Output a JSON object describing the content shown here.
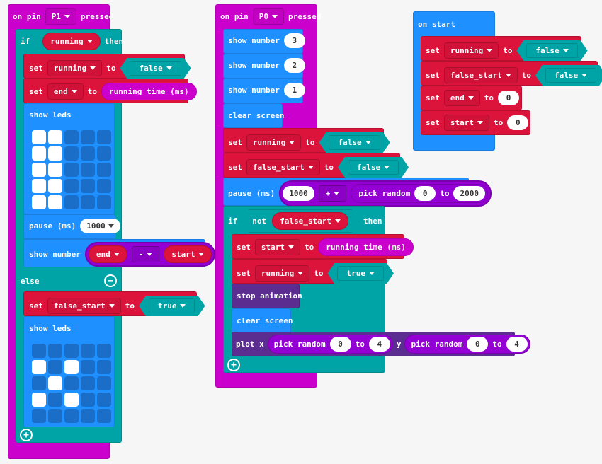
{
  "colors": {
    "background": "#f6f6f6",
    "events": "#cc00cc",
    "logic": "#00a4a6",
    "variables": "#dc143c",
    "basic": "#1e90ff",
    "led": "#5c2d91",
    "math": "#9400d3"
  },
  "stack1": {
    "event": {
      "prefix": "on pin",
      "pin": "P1",
      "suffix": "pressed"
    },
    "if": {
      "label": "if",
      "condition": "running",
      "then": "then"
    },
    "set_running": {
      "set": "set",
      "var": "running",
      "to": "to",
      "value": "false"
    },
    "set_end": {
      "set": "set",
      "var": "end",
      "to": "to",
      "value": "running time (ms)"
    },
    "show_leds_1": {
      "label": "show leds",
      "grid": [
        [
          1,
          1,
          0,
          0,
          0
        ],
        [
          1,
          1,
          0,
          0,
          0
        ],
        [
          1,
          1,
          0,
          0,
          0
        ],
        [
          1,
          1,
          0,
          0,
          0
        ],
        [
          1,
          1,
          0,
          0,
          0
        ]
      ]
    },
    "pause": {
      "label": "pause (ms)",
      "value": "1000"
    },
    "show_number": {
      "label": "show number",
      "left": "end",
      "op": "-",
      "right": "start"
    },
    "else": {
      "label": "else",
      "remove_icon": "minus-circle-icon"
    },
    "set_false_start": {
      "set": "set",
      "var": "false_start",
      "to": "to",
      "value": "true"
    },
    "show_leds_2": {
      "label": "show leds",
      "grid": [
        [
          0,
          0,
          0,
          0,
          0
        ],
        [
          1,
          0,
          1,
          0,
          0
        ],
        [
          0,
          1,
          0,
          0,
          0
        ],
        [
          1,
          0,
          1,
          0,
          0
        ],
        [
          0,
          0,
          0,
          0,
          0
        ]
      ]
    },
    "add_icon": "plus-circle-icon"
  },
  "stack2": {
    "event": {
      "prefix": "on pin",
      "pin": "P0",
      "suffix": "pressed"
    },
    "show3": {
      "label": "show number",
      "value": "3"
    },
    "show2": {
      "label": "show number",
      "value": "2"
    },
    "show1": {
      "label": "show number",
      "value": "1"
    },
    "clear1": {
      "label": "clear screen"
    },
    "set_running": {
      "set": "set",
      "var": "running",
      "to": "to",
      "value": "false"
    },
    "set_false_start": {
      "set": "set",
      "var": "false_start",
      "to": "to",
      "value": "false"
    },
    "pause": {
      "label": "pause (ms)",
      "value": "1000",
      "op": "+",
      "random_label": "pick random",
      "from": "0",
      "to_label": "to",
      "to": "2000"
    },
    "if": {
      "label": "if",
      "not": "not",
      "condition": "false_start",
      "then": "then"
    },
    "set_start": {
      "set": "set",
      "var": "start",
      "to": "to",
      "value": "running time (ms)"
    },
    "set_running_true": {
      "set": "set",
      "var": "running",
      "to": "to",
      "value": "true"
    },
    "stop_animation": {
      "label": "stop animation"
    },
    "clear2": {
      "label": "clear screen"
    },
    "plot": {
      "label": "plot x",
      "random_label": "pick random",
      "x_from": "0",
      "to_label": "to",
      "x_to": "4",
      "y_label": "y",
      "y_from": "0",
      "y_to": "4"
    },
    "add_icon": "plus-circle-icon"
  },
  "stack3": {
    "event": {
      "label": "on start"
    },
    "set_running": {
      "set": "set",
      "var": "running",
      "to": "to",
      "value": "false"
    },
    "set_false_start": {
      "set": "set",
      "var": "false_start",
      "to": "to",
      "value": "false"
    },
    "set_end": {
      "set": "set",
      "var": "end",
      "to": "to",
      "value": "0"
    },
    "set_start": {
      "set": "set",
      "var": "start",
      "to": "to",
      "value": "0"
    }
  }
}
